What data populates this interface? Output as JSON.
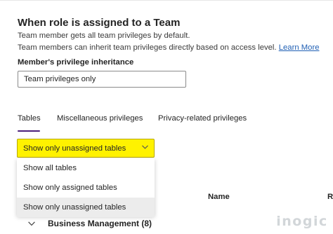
{
  "section": {
    "heading": "When role is assigned to a Team",
    "description_line1": "Team member gets all team privileges by default.",
    "description_line2": "Team members can inherit team privileges directly based on access level. ",
    "learn_more": "Learn More"
  },
  "inheritance": {
    "label": "Member's privilege inheritance",
    "selected": "Team privileges only"
  },
  "tabs": [
    {
      "label": "Tables",
      "active": true
    },
    {
      "label": "Miscellaneous privileges",
      "active": false
    },
    {
      "label": "Privacy-related privileges",
      "active": false
    }
  ],
  "filter": {
    "selected": "Show only unassigned tables",
    "highlight_color": "#fff200",
    "options": [
      {
        "label": "Show all tables"
      },
      {
        "label": "Show only assigned tables"
      },
      {
        "label": "Show only unassigned tables",
        "hovered": true
      }
    ]
  },
  "table": {
    "columns": [
      "Name",
      "R"
    ],
    "groups": [
      {
        "label": "Business Management (8)",
        "expanded": true
      }
    ]
  },
  "watermark": {
    "text": "inogic"
  },
  "colors": {
    "link": "#1f5fb4",
    "tab_underline": "#4a1f7a",
    "hover": "#ececec"
  }
}
